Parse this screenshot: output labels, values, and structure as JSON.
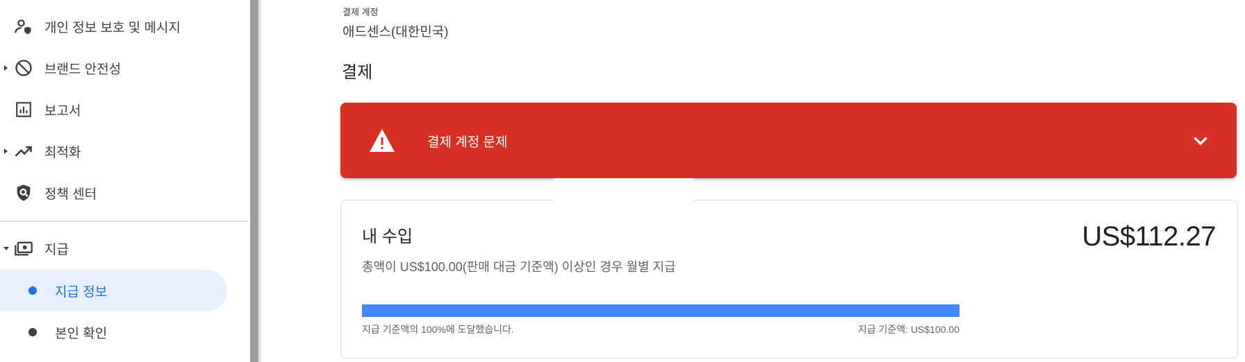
{
  "sidebar": {
    "items": [
      {
        "label": "개인 정보 보호 및 메시지",
        "icon": "privacy-messaging-icon",
        "expandable": false
      },
      {
        "label": "브랜드 안전성",
        "icon": "block-icon",
        "expandable": true
      },
      {
        "label": "보고서",
        "icon": "bar-chart-icon",
        "expandable": false
      },
      {
        "label": "최적화",
        "icon": "trending-up-icon",
        "expandable": true
      },
      {
        "label": "정책 센터",
        "icon": "policy-shield-icon",
        "expandable": false
      }
    ],
    "payments": {
      "label": "지급",
      "icon": "payments-icon",
      "expanded": true,
      "children": [
        {
          "label": "지급 정보",
          "active": true
        },
        {
          "label": "본인 확인",
          "active": false
        }
      ]
    }
  },
  "main": {
    "account": {
      "caption": "결제 계정",
      "value": "애드센스(대한민국)"
    },
    "section_title": "결제",
    "alert": {
      "title": "결제 계정 문제",
      "color": "#d93025"
    },
    "earnings": {
      "title": "내 수입",
      "amount": "US$112.27",
      "description": "총액이 US$100.00(판매 대금 기준액) 이상인 경우 월별 지급",
      "progress_percent": 100,
      "progress_left": "지급 기준액의 100%에 도달했습니다.",
      "progress_right": "지급 기준액: US$100.00",
      "progress_color": "#4285f4"
    }
  },
  "colors": {
    "accent": "#1a73e8",
    "active_bg": "#e8f0fe",
    "error": "#d93025"
  }
}
